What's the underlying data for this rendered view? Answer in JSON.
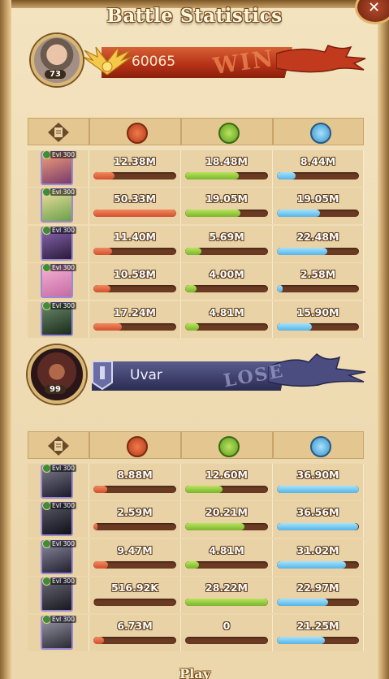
{
  "header": {
    "title": "Battle Statistics"
  },
  "player": {
    "level": "73",
    "score": "60065",
    "result": "WIN"
  },
  "enemy": {
    "level": "99",
    "name": "Uvar",
    "result": "LOSE"
  },
  "stat_columns": [
    {
      "icon": "damage-icon",
      "color": "#d2502e"
    },
    {
      "icon": "heal-icon",
      "color": "#7ab52d"
    },
    {
      "icon": "shield-icon",
      "color": "#58b4e4"
    }
  ],
  "ally_heroes": [
    {
      "evolution": "Evl 300",
      "damage": "12.38M",
      "healing": "18.48M",
      "damage_taken": "8.44M",
      "damage_fill": 0.25,
      "healing_fill": 0.65,
      "taken_fill": 0.23
    },
    {
      "evolution": "Evl 300",
      "damage": "50.33M",
      "healing": "19.05M",
      "damage_taken": "19.05M",
      "damage_fill": 1.0,
      "healing_fill": 0.67,
      "taken_fill": 0.52
    },
    {
      "evolution": "Evl 300",
      "damage": "11.40M",
      "healing": "5.69M",
      "damage_taken": "22.48M",
      "damage_fill": 0.23,
      "healing_fill": 0.2,
      "taken_fill": 0.61
    },
    {
      "evolution": "Evl 300",
      "damage": "10.58M",
      "healing": "4.00M",
      "damage_taken": "2.58M",
      "damage_fill": 0.21,
      "healing_fill": 0.14,
      "taken_fill": 0.07
    },
    {
      "evolution": "Evl 300",
      "damage": "17.24M",
      "healing": "4.81M",
      "damage_taken": "15.90M",
      "damage_fill": 0.34,
      "healing_fill": 0.17,
      "taken_fill": 0.43
    }
  ],
  "enemy_heroes": [
    {
      "evolution": "Evl 300",
      "damage": "8.88M",
      "healing": "12.60M",
      "damage_taken": "36.90M",
      "damage_fill": 0.17,
      "healing_fill": 0.45,
      "taken_fill": 1.0
    },
    {
      "evolution": "Evl 300",
      "damage": "2.59M",
      "healing": "20.21M",
      "damage_taken": "36.56M",
      "damage_fill": 0.05,
      "healing_fill": 0.72,
      "taken_fill": 0.99
    },
    {
      "evolution": "Evl 300",
      "damage": "9.47M",
      "healing": "4.81M",
      "damage_taken": "31.02M",
      "damage_fill": 0.18,
      "healing_fill": 0.17,
      "taken_fill": 0.84
    },
    {
      "evolution": "Evl 300",
      "damage": "516.92K",
      "healing": "28.22M",
      "damage_taken": "22.97M",
      "damage_fill": 0.01,
      "healing_fill": 1.0,
      "taken_fill": 0.62
    },
    {
      "evolution": "Evl 300",
      "damage": "6.73M",
      "healing": "0",
      "damage_taken": "21.25M",
      "damage_fill": 0.13,
      "healing_fill": 0.0,
      "taken_fill": 0.58
    }
  ],
  "footer": {
    "play_label": "Play"
  }
}
